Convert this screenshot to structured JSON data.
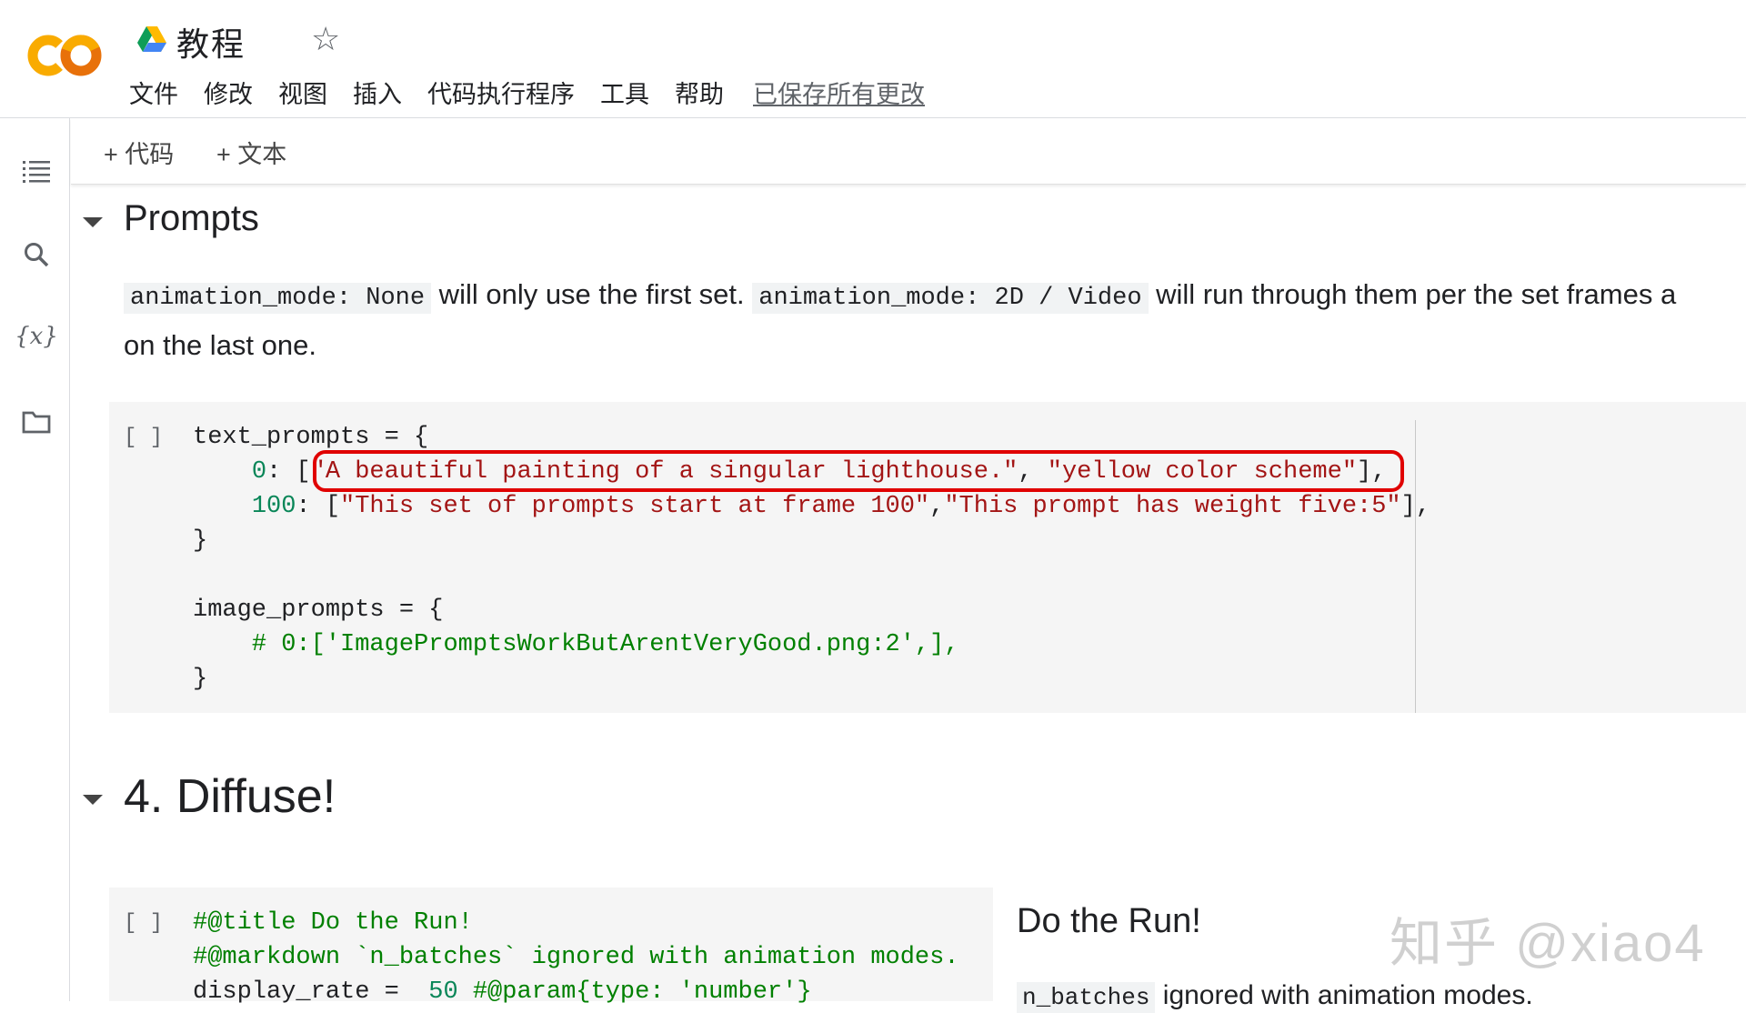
{
  "app": {
    "notebook_title": "教程",
    "menu": [
      "文件",
      "修改",
      "视图",
      "插入",
      "代码执行程序",
      "工具",
      "帮助"
    ],
    "save_status": "已保存所有更改"
  },
  "toolbar": {
    "add_code": "+ 代码",
    "add_text": "+ 文本"
  },
  "sidebar": {
    "items": [
      "toc-icon",
      "search-icon",
      "variables-icon",
      "folder-icon"
    ],
    "variables_label": "{x}"
  },
  "sections": {
    "prompts": {
      "heading": "Prompts",
      "md_code1": "animation_mode: None",
      "md_text1": " will only use the first set. ",
      "md_code2": "animation_mode: 2D / Video",
      "md_text2": " will run through them per the set frames a",
      "md_line2": "on the last one."
    },
    "diffuse": {
      "heading": "4. Diffuse!"
    }
  },
  "cells": {
    "prompts_cell": {
      "run_label": "[ ]",
      "line1": "text_prompts = {",
      "line2_key": "0",
      "line2_str1": "\"A beautiful painting of a singular lighthouse.\"",
      "line2_str2": "\"yellow color scheme\"",
      "line3_key": "100",
      "line3_str1": "\"This set of prompts start at frame 100\"",
      "line3_str2": "\"This prompt has weight five:5\"",
      "line4": "}",
      "line6": "image_prompts = {",
      "line7": "# 0:['ImagePromptsWorkButArentVeryGood.png:2',],",
      "line8": "}"
    },
    "run_cell": {
      "run_label": "[ ]",
      "line1": "#@title Do the Run!",
      "line2": "#@markdown `n_batches` ignored with animation modes.",
      "line3_a": "display_rate =  ",
      "line3_num": "50",
      "line3_com": " #@param{type: 'number'}",
      "form_title": "Do the Run!",
      "form_code": "n_batches",
      "form_text": " ignored with animation modes."
    }
  },
  "watermark": "知乎 @xiao4",
  "colors": {
    "highlight_border": "#e00000",
    "number": "#098658",
    "string": "#a31515",
    "comment": "#008000",
    "logo_orange": "#f9ab00",
    "logo_dark_orange": "#e8710a"
  }
}
